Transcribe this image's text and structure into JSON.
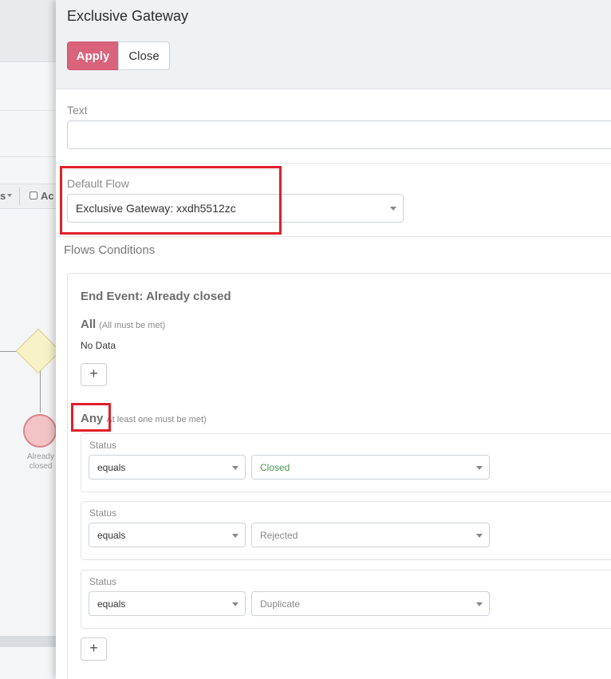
{
  "background": {
    "toolbar_fragment_1": "s",
    "toolbar_fragment_2": "Ac",
    "end_event_label": "Already closed",
    "colors": {
      "gateway_fill": "#f7f2c8",
      "end_event_fill": "#f3c3c6"
    }
  },
  "panel": {
    "title": "Exclusive Gateway",
    "apply_label": "Apply",
    "close_label": "Close",
    "text_field": {
      "label": "Text",
      "value": ""
    },
    "default_flow": {
      "label": "Default Flow",
      "value": "Exclusive Gateway: xxdh5512zc"
    },
    "flows_conditions_label": "Flows Conditions",
    "flow": {
      "title": "End Event: Already closed",
      "all": {
        "label": "All",
        "hint": "(All must be met)",
        "empty_text": "No Data"
      },
      "any": {
        "label": "Any",
        "hint": "At least one must be met)",
        "conditions": [
          {
            "field": "Status",
            "operator": "equals",
            "value": "Closed"
          },
          {
            "field": "Status",
            "operator": "equals",
            "value": "Rejected"
          },
          {
            "field": "Status",
            "operator": "equals",
            "value": "Duplicate"
          }
        ]
      },
      "add_label": "+"
    }
  },
  "colors": {
    "apply_button": "#d9637b",
    "highlight": "#e0202a",
    "positive_value": "#4a9a52"
  }
}
